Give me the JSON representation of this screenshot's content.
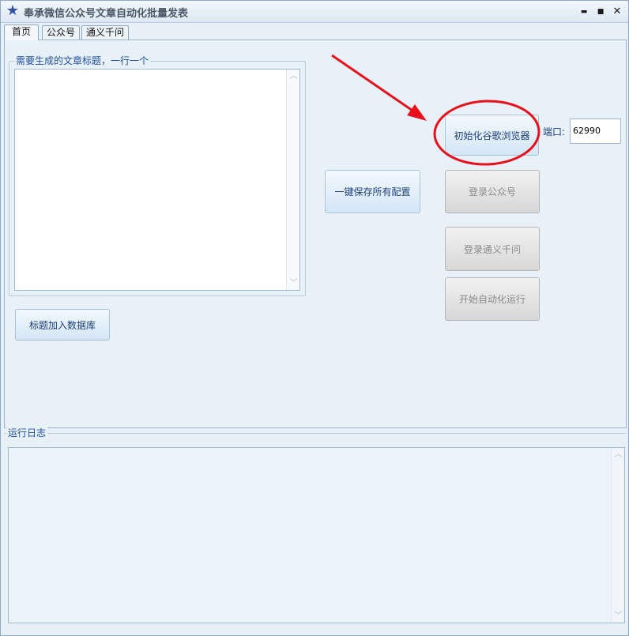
{
  "window": {
    "title": "奉承微信公众号文章自动化批量发表",
    "minimize": "▬",
    "maximize": "■",
    "close": "✕"
  },
  "tabs": [
    {
      "label": "首页",
      "active": true
    },
    {
      "label": "公众号",
      "active": false
    },
    {
      "label": "通义千问",
      "active": false
    }
  ],
  "home": {
    "titles_group_label": "需要生成的文章标题，一行一个",
    "titles_value": "",
    "add_titles_button": "标题加入数据库",
    "save_config_button": "一键保存所有配置",
    "init_browser_button": "初始化谷歌浏览器",
    "port_label": "端口:",
    "port_value": "62990",
    "login_wechat_button": "登录公众号",
    "login_qwen_button": "登录通义千问",
    "start_auto_button": "开始自动化运行"
  },
  "log": {
    "group_label": "运行日志",
    "content": ""
  },
  "annotation": {
    "color": "#e8111b"
  }
}
